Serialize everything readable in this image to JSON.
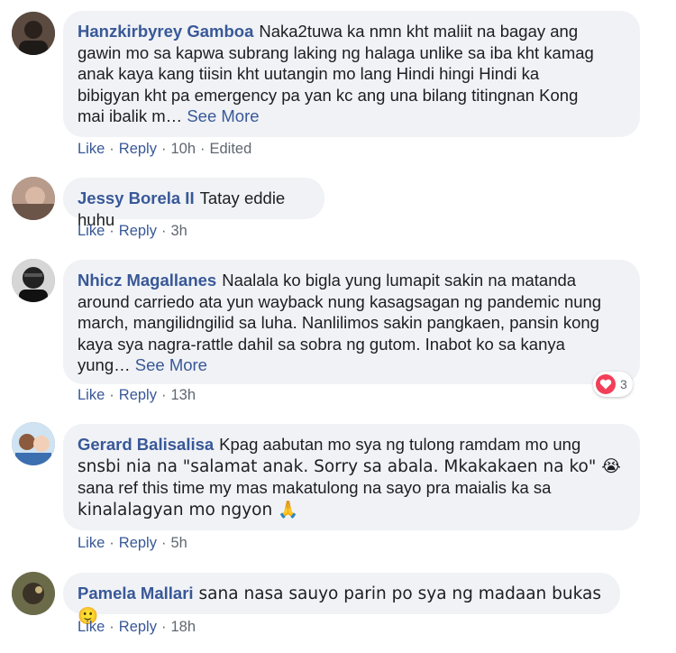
{
  "comments": [
    {
      "author": "Hanzkirbyrey Gamboa",
      "lines": [
        "Naka2tuwa ka nmn kht maliit na bagay ang",
        "gawin mo sa kapwa subrang laking ng halaga unlike sa iba kht kamag",
        "anak kaya kang tiisin kht uutangin mo lang Hindi hingi Hindi ka",
        "bibigyan kht pa emergency pa yan kc ang una bilang titingnan Kong",
        "mai ibalik m…"
      ],
      "see_more": "See More",
      "like": "Like",
      "reply": "Reply",
      "time": "10h",
      "extra": "Edited"
    },
    {
      "author": "Jessy Borela II",
      "lines": [
        "Tatay eddie huhu"
      ],
      "like": "Like",
      "reply": "Reply",
      "time": "3h"
    },
    {
      "author": "Nhicz Magallanes",
      "lines": [
        "Naalala ko bigla yung lumapit sakin na matanda",
        "around carriedo ata yun wayback nung kasagsagan ng pandemic nung",
        "march, mangilidngilid sa luha. Nanlilimos sakin pangkaen, pansin kong",
        "kaya sya nagra-rattle dahil sa sobra ng gutom. Inabot ko sa kanya",
        "yung…"
      ],
      "see_more": "See More",
      "like": "Like",
      "reply": "Reply",
      "time": "13h",
      "reaction_count": "3",
      "reaction_icon": "heart-icon"
    },
    {
      "author": "Gerard Balisalisa",
      "lines": [
        "Kpag aabutan mo sya ng tulong ramdam mo ung",
        "snsbi nia na \"salamat anak. Sorry sa abala. Mkakakaen na ko\" 😭",
        "sana ref this time my mas makatulong na sayo pra maialis ka sa",
        "kinalalagyan mo ngyon 🙏"
      ],
      "like": "Like",
      "reply": "Reply",
      "time": "5h"
    },
    {
      "author": "Pamela Mallari",
      "lines": [
        "sana nasa sauyo parin po sya ng madaan bukas 🙂"
      ],
      "like": "Like",
      "reply": "Reply",
      "time": "18h"
    }
  ],
  "separator": "·",
  "colors": {
    "link": "#385898",
    "bubble": "#f0f2f5",
    "heart": "#f33e58"
  }
}
